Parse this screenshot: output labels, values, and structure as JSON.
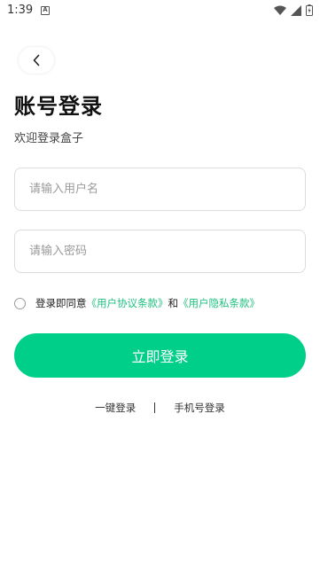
{
  "status_bar": {
    "time": "1:39",
    "a_icon": "A",
    "icons": [
      "wifi-icon",
      "signal-icon",
      "battery-charging-icon"
    ]
  },
  "header": {
    "back_icon": "chevron-left-icon"
  },
  "title": "账号登录",
  "subtitle": "欢迎登录盒子",
  "form": {
    "username_placeholder": "请输入用户名",
    "username_value": "",
    "password_placeholder": "请输入密码",
    "password_value": ""
  },
  "agreement": {
    "prefix": "登录即同意",
    "user_agreement": "《用户协议条款》",
    "conjunction": "和",
    "privacy_policy": "《用户隐私条款》",
    "checked": false
  },
  "login_button": "立即登录",
  "alt_login": {
    "one_click": "一键登录",
    "phone": "手机号登录"
  },
  "colors": {
    "accent": "#00cf8a",
    "link": "#1fc081"
  }
}
